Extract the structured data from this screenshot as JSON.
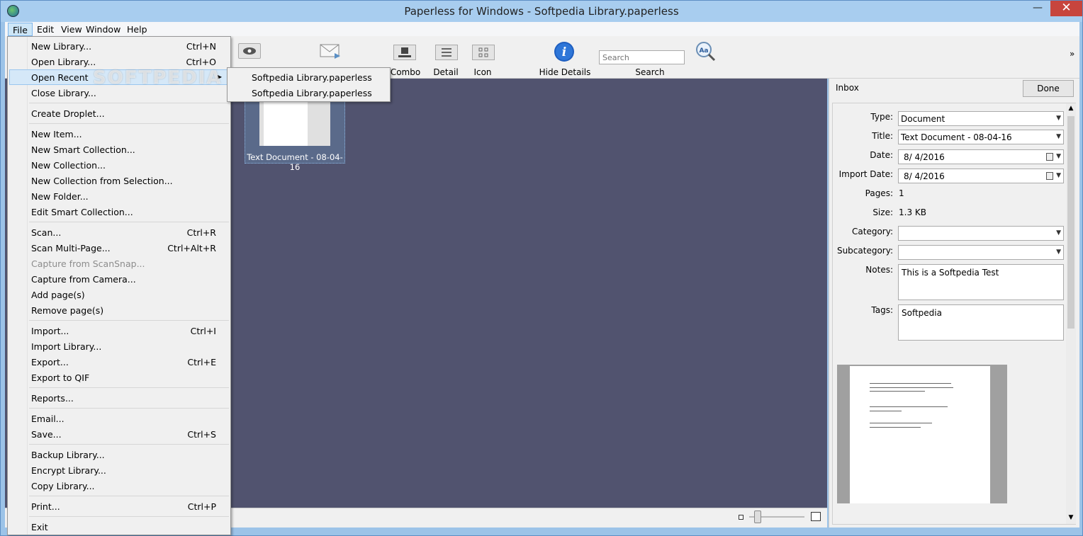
{
  "window": {
    "title": "Paperless for Windows - Softpedia Library.paperless",
    "minimize": "—",
    "maximize": "☐",
    "close": "✕"
  },
  "menubar": [
    "File",
    "Edit",
    "View",
    "Window",
    "Help"
  ],
  "toolbar": {
    "combo": "Combo",
    "detail": "Detail",
    "icon": "Icon",
    "hide_details": "Hide Details",
    "search_label": "Search",
    "search_placeholder": "Search",
    "overflow": "»"
  },
  "thumbnail": {
    "label": "Text Document -  08-04-16"
  },
  "watermark": "SOFTPEDIA",
  "file_menu": {
    "items": [
      {
        "label": "New Library...",
        "shortcut": "Ctrl+N"
      },
      {
        "label": "Open Library...",
        "shortcut": "Ctrl+O"
      },
      {
        "label": "Open Recent",
        "shortcut": ""
      },
      {
        "label": "Close Library...",
        "shortcut": ""
      },
      {
        "label": "Create Droplet...",
        "shortcut": ""
      },
      {
        "label": "New Item...",
        "shortcut": ""
      },
      {
        "label": "New Smart Collection...",
        "shortcut": ""
      },
      {
        "label": "New Collection...",
        "shortcut": ""
      },
      {
        "label": "New Collection from Selection...",
        "shortcut": ""
      },
      {
        "label": "New Folder...",
        "shortcut": ""
      },
      {
        "label": "Edit Smart Collection...",
        "shortcut": ""
      },
      {
        "label": "Scan...",
        "shortcut": "Ctrl+R"
      },
      {
        "label": "Scan Multi-Page...",
        "shortcut": "Ctrl+Alt+R"
      },
      {
        "label": "Capture from ScanSnap...",
        "shortcut": ""
      },
      {
        "label": "Capture from Camera...",
        "shortcut": ""
      },
      {
        "label": "Add page(s)",
        "shortcut": ""
      },
      {
        "label": "Remove page(s)",
        "shortcut": ""
      },
      {
        "label": "Import...",
        "shortcut": "Ctrl+I"
      },
      {
        "label": "Import Library...",
        "shortcut": ""
      },
      {
        "label": "Export...",
        "shortcut": "Ctrl+E"
      },
      {
        "label": "Export to QIF",
        "shortcut": ""
      },
      {
        "label": "Reports...",
        "shortcut": ""
      },
      {
        "label": "Email...",
        "shortcut": ""
      },
      {
        "label": "Save...",
        "shortcut": "Ctrl+S"
      },
      {
        "label": "Backup Library...",
        "shortcut": ""
      },
      {
        "label": "Encrypt Library...",
        "shortcut": ""
      },
      {
        "label": "Copy Library...",
        "shortcut": ""
      },
      {
        "label": "Print...",
        "shortcut": "Ctrl+P"
      },
      {
        "label": "Exit",
        "shortcut": ""
      }
    ]
  },
  "recent_menu": {
    "items": [
      "Softpedia Library.paperless",
      "Softpedia Library.paperless"
    ]
  },
  "details": {
    "inbox": "Inbox",
    "done": "Done",
    "type_label": "Type:",
    "type_value": "Document",
    "title_label": "Title:",
    "title_value": "Text Document -  08-04-16",
    "date_label": "Date:",
    "date_value": "8/  4/2016",
    "import_date_label": "Import Date:",
    "import_date_value": "8/  4/2016",
    "pages_label": "Pages:",
    "pages_value": "1",
    "size_label": "Size:",
    "size_value": "1.3 KB",
    "category_label": "Category:",
    "category_value": "",
    "subcategory_label": "Subcategory:",
    "subcategory_value": "",
    "notes_label": "Notes:",
    "notes_value": "This is a Softpedia Test",
    "tags_label": "Tags:",
    "tags_value": "Softpedia"
  }
}
